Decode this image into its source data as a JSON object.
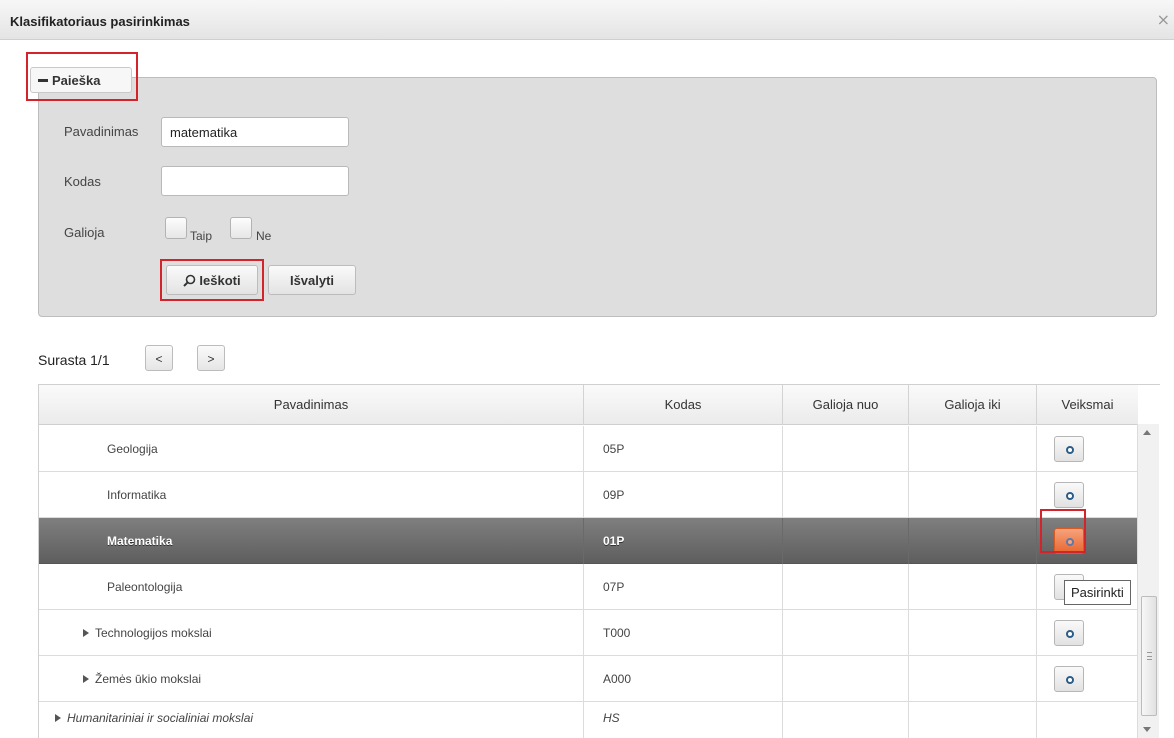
{
  "window": {
    "title": "Klasifikatoriaus pasirinkimas",
    "close_glyph": "×"
  },
  "search": {
    "legend": "Paieška",
    "name_label": "Pavadinimas",
    "name_value": "matematika",
    "code_label": "Kodas",
    "code_value": "",
    "valid_label": "Galioja",
    "yes_label": "Taip",
    "no_label": "Ne",
    "search_button": "Ieškoti",
    "clear_button": "Išvalyti"
  },
  "pager": {
    "label": "Surasta 1/1",
    "prev": "<",
    "next": ">"
  },
  "table": {
    "headers": [
      "Pavadinimas",
      "Kodas",
      "Galioja nuo",
      "Galioja iki",
      "Veiksmai"
    ],
    "rows": [
      {
        "name": "Geologija",
        "code": "05P",
        "from": "",
        "to": ""
      },
      {
        "name": "Informatika",
        "code": "09P",
        "from": "",
        "to": ""
      },
      {
        "name": "Matematika",
        "code": "01P",
        "from": "",
        "to": ""
      },
      {
        "name": "Paleontologija",
        "code": "07P",
        "from": "",
        "to": ""
      },
      {
        "name": "Technologijos mokslai",
        "code": "T000",
        "from": "",
        "to": ""
      },
      {
        "name": "Žemės ūkio mokslai",
        "code": "A000",
        "from": "",
        "to": ""
      },
      {
        "name": "Humanitariniai ir socialiniai mokslai",
        "code": "HS",
        "from": "",
        "to": ""
      }
    ]
  },
  "tooltip": "Pasirinkti",
  "colors": {
    "highlight": "#d4242b",
    "selected_row": "#6e6e6e",
    "hot_button": "#ec7a45"
  },
  "icons": {
    "search": "magnifier-icon",
    "select": "circle-dot-icon",
    "expand": "triangle-right-icon"
  }
}
